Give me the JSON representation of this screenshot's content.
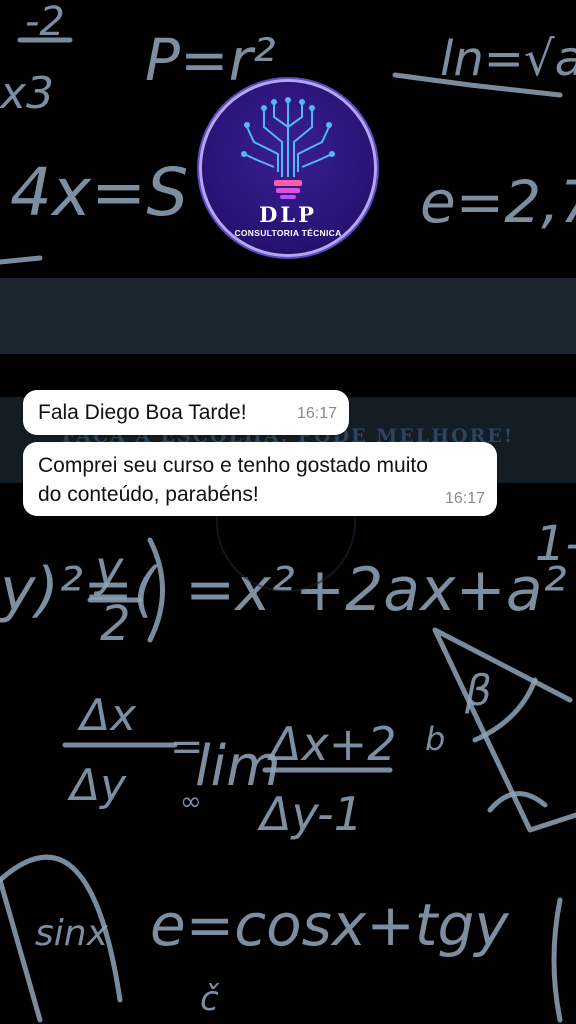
{
  "background": {
    "equations": [
      "-2",
      "x3",
      "P=r²",
      "ln=√a",
      "4x=S",
      "e=2,7",
      "(y/2)²=x²+2ax+a²",
      "Δx/Δy = lim Δx+2/Δy-1",
      "e=cosx+tgy",
      "sinx",
      "β",
      "b"
    ]
  },
  "logo": {
    "brand": "DLP",
    "subtitle": "CONSULTORIA TÉCNICA",
    "colors": {
      "circle": "#2a1478",
      "ring": "#b3a7f0",
      "circuit": "#4fb8ff",
      "bulb_base": "#ff5ca8"
    }
  },
  "banner_text": "FAÇA A ESCOLHA, PODE MELHORE!",
  "chat": {
    "messages": [
      {
        "text": "Fala Diego Boa Tarde!",
        "time": "16:17"
      },
      {
        "text": "Comprei seu curso e tenho gostado muito do conteúdo, parabéns!",
        "time": "16:17"
      }
    ]
  },
  "colors": {
    "background": "#000000",
    "bubble": "#ffffff",
    "chalk": "#8fa3b8"
  }
}
